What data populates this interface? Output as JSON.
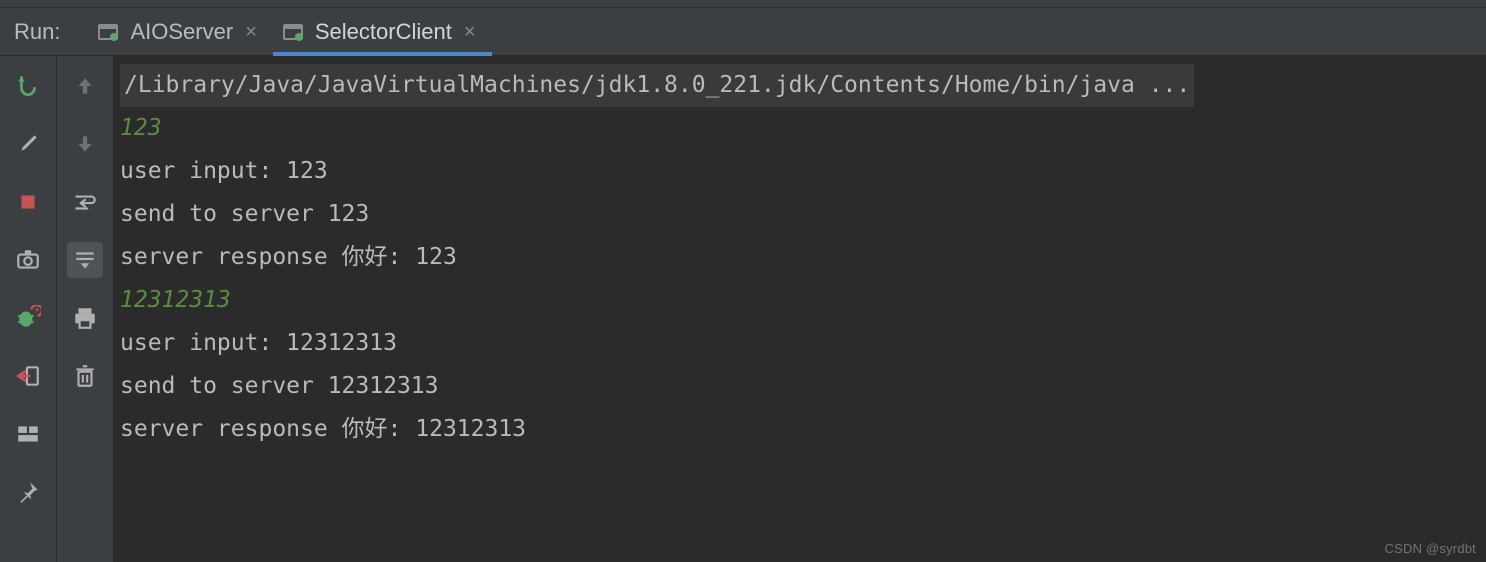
{
  "header": {
    "run_label": "Run:",
    "tabs": [
      {
        "label": "AIOServer",
        "active": false
      },
      {
        "label": "SelectorClient",
        "active": true
      }
    ]
  },
  "console": {
    "lines": [
      {
        "type": "cmd",
        "text": "/Library/Java/JavaVirtualMachines/jdk1.8.0_221.jdk/Contents/Home/bin/java ..."
      },
      {
        "type": "in",
        "text": "123"
      },
      {
        "type": "out",
        "text": "user input: 123"
      },
      {
        "type": "out",
        "text": "send to server 123"
      },
      {
        "type": "out",
        "text": "server response 你好: 123"
      },
      {
        "type": "in",
        "text": "12312313"
      },
      {
        "type": "out",
        "text": "user input: 12312313"
      },
      {
        "type": "out",
        "text": "send to server 12312313"
      },
      {
        "type": "out",
        "text": "server response 你好: 12312313"
      }
    ]
  },
  "toolbar_outer": [
    {
      "name": "rerun-icon",
      "color": "#59a869"
    },
    {
      "name": "wrench-icon",
      "color": "#aeb0b2"
    },
    {
      "name": "stop-icon",
      "color": "#c75450"
    },
    {
      "name": "camera-icon",
      "color": "#aeb0b2"
    },
    {
      "name": "bug-restart-icon",
      "color": "#59a869"
    },
    {
      "name": "exit-icon",
      "color": "#c75450"
    },
    {
      "name": "layout-icon",
      "color": "#aeb0b2"
    },
    {
      "name": "pin-icon",
      "color": "#aeb0b2"
    }
  ],
  "toolbar_inner": [
    {
      "name": "arrow-up-icon",
      "color": "#6e7275"
    },
    {
      "name": "arrow-down-icon",
      "color": "#6e7275"
    },
    {
      "name": "soft-wrap-icon",
      "color": "#aeb0b2"
    },
    {
      "name": "scroll-to-end-icon",
      "color": "#aeb0b2",
      "selected": true
    },
    {
      "name": "print-icon",
      "color": "#aeb0b2"
    },
    {
      "name": "trash-icon",
      "color": "#aeb0b2"
    }
  ],
  "watermark": "CSDN @syrdbt"
}
